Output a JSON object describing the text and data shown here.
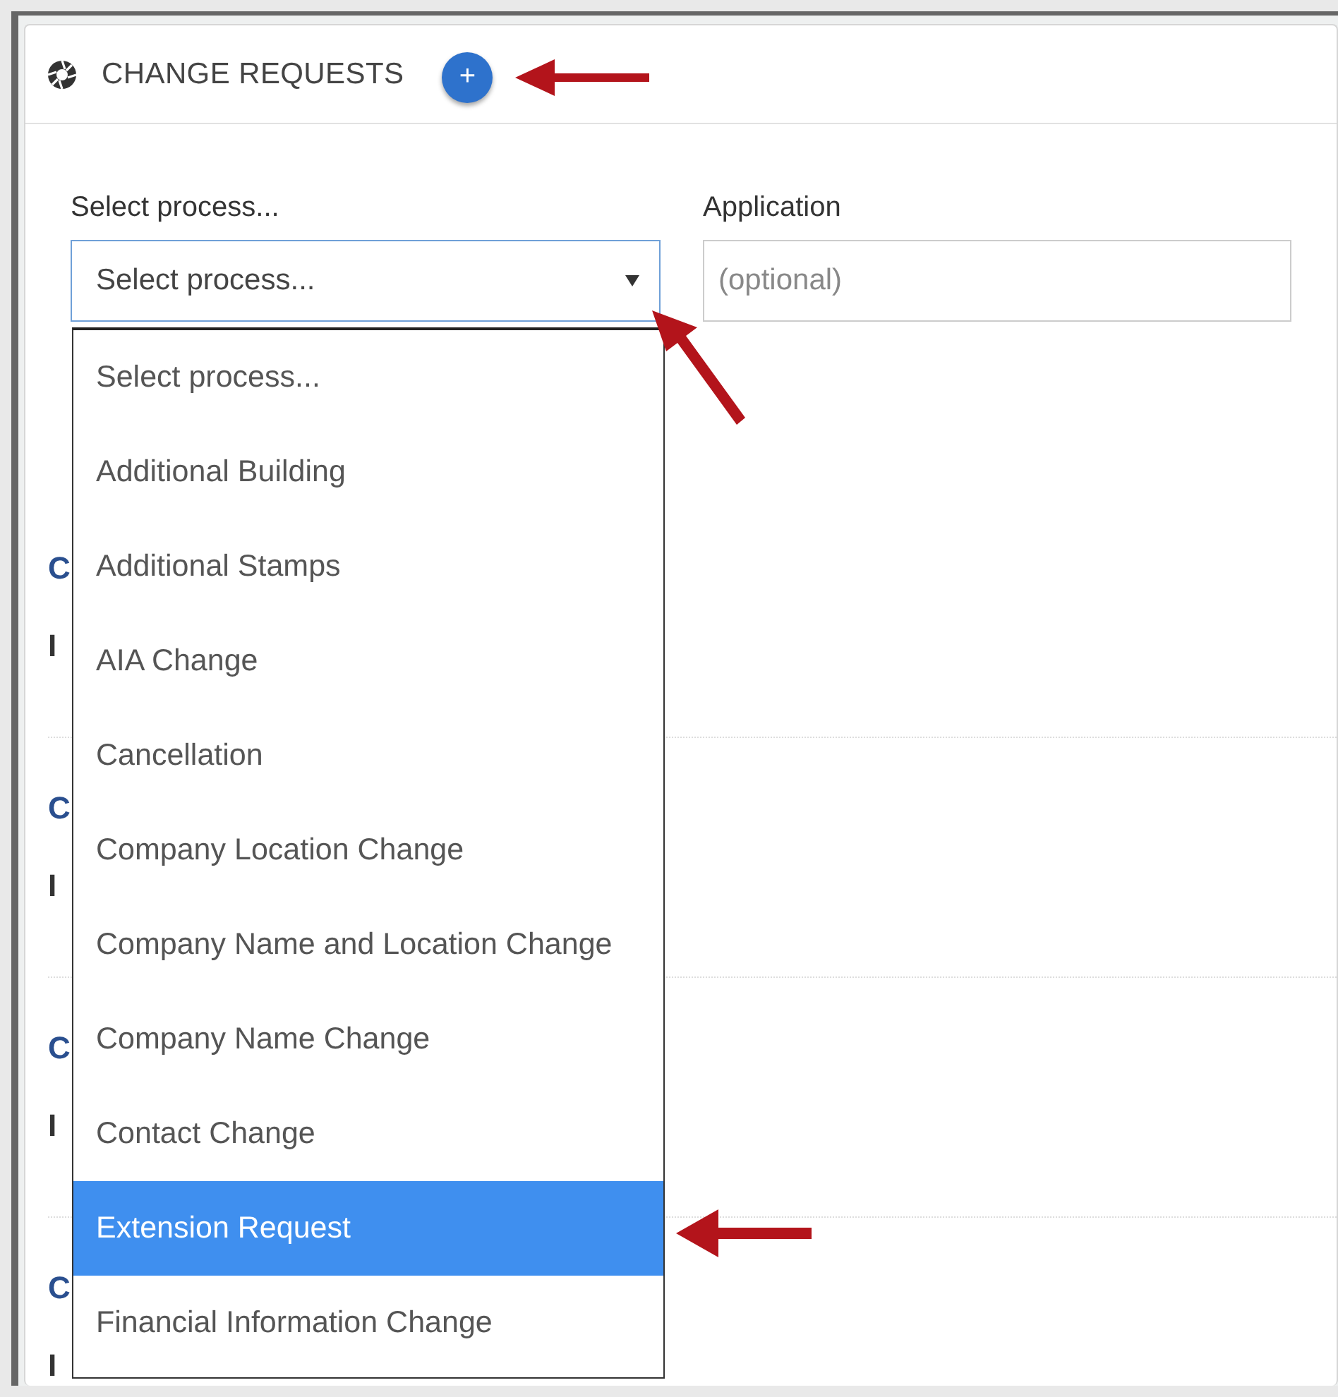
{
  "panel": {
    "title": "CHANGE REQUESTS",
    "add_button": "+"
  },
  "form": {
    "process_label": "Select process...",
    "process_value": "Select process...",
    "application_label": "Application",
    "application_placeholder": "(optional)"
  },
  "dropdown": {
    "expanded": true,
    "options": [
      {
        "label": "Select process...",
        "selected": false
      },
      {
        "label": "Additional Building",
        "selected": false
      },
      {
        "label": "Additional Stamps",
        "selected": false
      },
      {
        "label": "AIA Change",
        "selected": false
      },
      {
        "label": "Cancellation",
        "selected": false
      },
      {
        "label": "Company Location Change",
        "selected": false
      },
      {
        "label": "Company Name and Location Change",
        "selected": false
      },
      {
        "label": "Company Name Change",
        "selected": false
      },
      {
        "label": "Contact Change",
        "selected": false
      },
      {
        "label": "Extension Request",
        "selected": true
      },
      {
        "label": "Financial Information Change",
        "selected": false
      }
    ]
  },
  "requests": [
    {
      "title": "C",
      "subtitle": "I"
    },
    {
      "title": "C",
      "subtitle": "I"
    },
    {
      "title": "C",
      "subtitle": "I"
    },
    {
      "title": "C",
      "subtitle": "I"
    }
  ]
}
